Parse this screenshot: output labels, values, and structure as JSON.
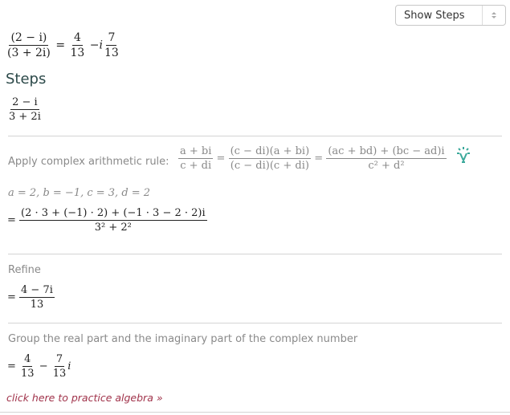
{
  "toolbar": {
    "steps_select": {
      "selected": "Show Steps"
    }
  },
  "result": {
    "lhs_num": "(2 − i)",
    "lhs_den": "(3 + 2i)",
    "eq": "=",
    "r1_num": "4",
    "r1_den": "13",
    "minus": "−",
    "i": "i",
    "r2_num": "7",
    "r2_den": "13"
  },
  "steps_title": "Steps",
  "start_expr": {
    "num": "2 − i",
    "den": "3 + 2i"
  },
  "steps": [
    {
      "label": "Apply complex arithmetic rule:",
      "rule": {
        "f1_num": "a + bi",
        "f1_den": "c + di",
        "f2_num": "(c − di)(a + bi)",
        "f2_den": "(c − di)(c + di)",
        "f3_num": "(ac + bd) + (bc − ad)i",
        "f3_den": "c² + d²"
      },
      "hint_icon": "lightbulb-icon",
      "assign": "a = 2, b = −1, c = 3, d = 2",
      "result_num": "(2 · 3 + (−1) · 2) + (−1 · 3 − 2 · 2)i",
      "result_den": "3² + 2²"
    },
    {
      "label": "Refine",
      "result_num": "4 − 7i",
      "result_den": "13"
    },
    {
      "label": "Group the real part and the imaginary part of the complex number",
      "r1_num": "4",
      "r1_den": "13",
      "r2_num": "7",
      "r2_den": "13",
      "suffix": "i"
    }
  ],
  "practice_link": "click here to practice algebra »",
  "colors": {
    "accent": "#3aa89a",
    "link": "#a0324a",
    "heading": "#2d4a4a"
  }
}
